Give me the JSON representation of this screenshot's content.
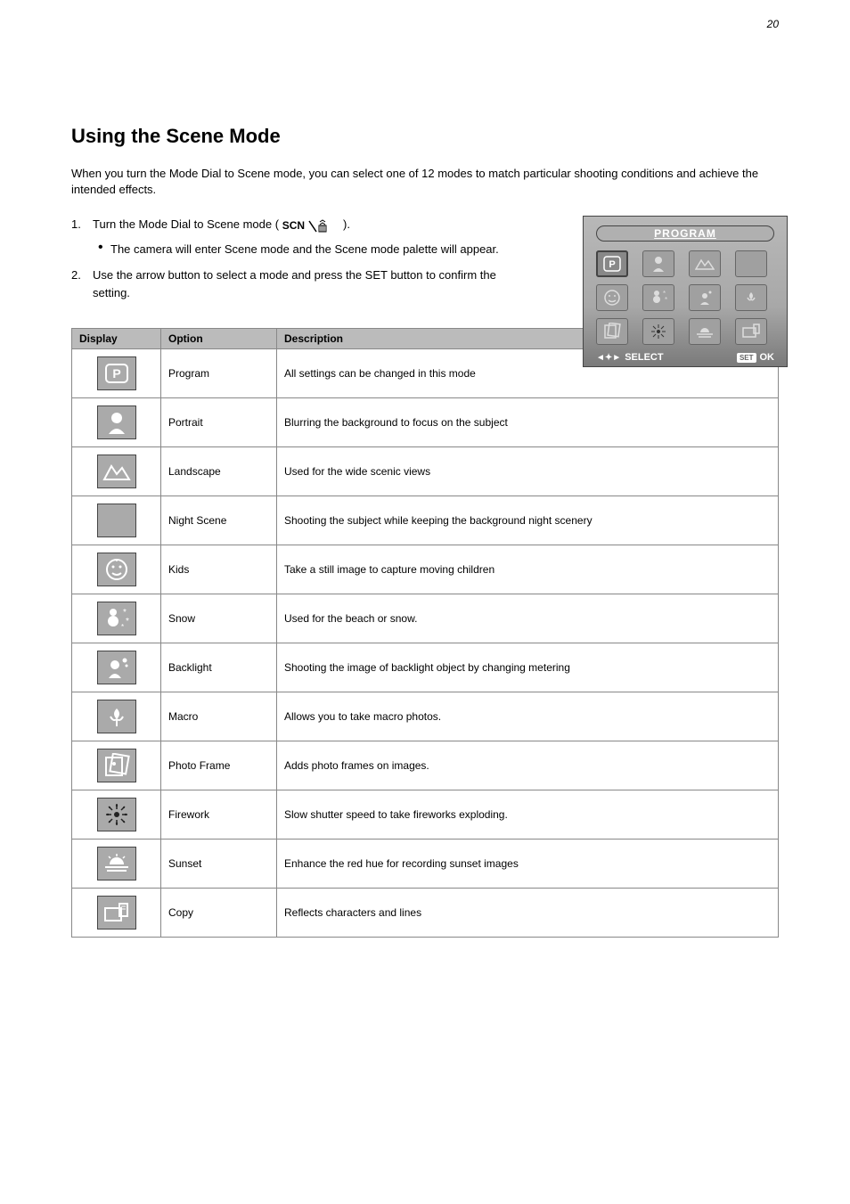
{
  "page_number": "20",
  "title": "Using the Scene Mode",
  "intro": "When you turn the Mode Dial to Scene mode, you can select one of 12 modes to match particular shooting conditions and achieve the intended effects.",
  "steps": [
    {
      "num": "1.",
      "text_a": "Turn the Mode Dial to Scene mode (",
      "text_b": ")."
    },
    {
      "bullet": true,
      "text": "The camera will enter Scene mode and the Scene mode palette will appear."
    },
    {
      "num": "2.",
      "text": "Use the arrow button to select a mode and press the SET button to confirm the setting."
    }
  ],
  "screenshot": {
    "title": "PROGRAM",
    "footer_select": "SELECT",
    "footer_set": "SET",
    "footer_ok": "OK"
  },
  "table": {
    "headers": [
      "Display",
      "Option",
      "Description"
    ],
    "rows": [
      {
        "icon": "program",
        "option": "Program",
        "desc": "All settings can be changed in this mode"
      },
      {
        "icon": "portrait",
        "option": "Portrait",
        "desc": "Blurring the background to focus on the subject"
      },
      {
        "icon": "landscape",
        "option": "Landscape",
        "desc": "Used for the wide scenic views"
      },
      {
        "icon": "night-scene",
        "option": "Night Scene",
        "desc": "Shooting the subject while keeping the background night scenery"
      },
      {
        "icon": "kids",
        "option": "Kids",
        "desc": "Take a still image to capture moving children"
      },
      {
        "icon": "snow",
        "option": "Snow",
        "desc": "Used for the beach or snow."
      },
      {
        "icon": "backlight",
        "option": "Backlight",
        "desc": "Shooting the image of backlight object by changing metering"
      },
      {
        "icon": "macro",
        "option": "Macro",
        "desc": "Allows you to take macro photos."
      },
      {
        "icon": "photo-frame",
        "option": "Photo Frame",
        "desc": "Adds photo frames on images."
      },
      {
        "icon": "firework",
        "option": "Firework",
        "desc": "Slow shutter speed to take fireworks exploding."
      },
      {
        "icon": "sunset",
        "option": "Sunset",
        "desc": "Enhance the red hue for recording sunset images"
      },
      {
        "icon": "copy",
        "option": "Copy",
        "desc": "Reflects characters and lines"
      }
    ]
  }
}
